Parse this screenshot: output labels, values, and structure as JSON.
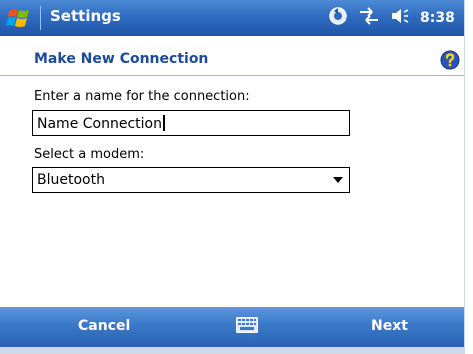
{
  "titlebar": {
    "title": "Settings",
    "time": "8:38",
    "icons": [
      "windows-start-icon",
      "sync-icon",
      "connectivity-icon",
      "volume-icon"
    ]
  },
  "heading": {
    "text": "Make New Connection",
    "help_icon": "help-icon"
  },
  "form": {
    "name_label": "Enter a name for the connection:",
    "name_value": "Name Connection",
    "modem_label": "Select a modem:",
    "modem_value": "Bluetooth"
  },
  "menubar": {
    "left": "Cancel",
    "right": "Next",
    "center_icon": "keyboard-icon"
  },
  "colors": {
    "bar_blue": "#2f6cc0",
    "heading_text": "#1e4a9a"
  }
}
